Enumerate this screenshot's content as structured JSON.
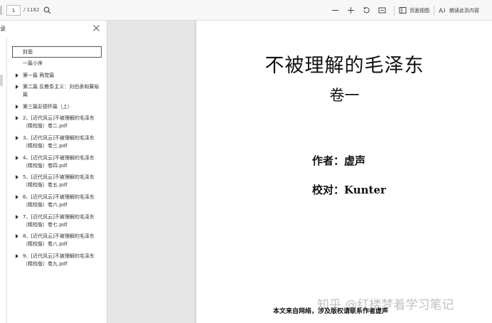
{
  "toolbar": {
    "page_current": "1",
    "page_total": "/ 1182",
    "page_view_label": "页面视图",
    "read_aloud_label": "朗读此页内容"
  },
  "sidebar": {
    "title": "录",
    "items": [
      {
        "label": "封面",
        "has_children": false,
        "selected": true
      },
      {
        "label": "一篇小序",
        "has_children": false,
        "selected": false
      },
      {
        "label": "第一篇 两党篇",
        "has_children": true,
        "selected": false
      },
      {
        "label": "第二篇 反教条主义：刘伯承和粟裕篇",
        "has_children": true,
        "selected": false
      },
      {
        "label": "第三篇彭德怀篇（上）",
        "has_children": true,
        "selected": false
      },
      {
        "label": "2、[近代风云]不被理解的毛泽东（精校版）卷二.pdf",
        "has_children": true,
        "selected": false
      },
      {
        "label": "3、[近代风云]不被理解的毛泽东（精校版）卷三.pdf",
        "has_children": true,
        "selected": false
      },
      {
        "label": "4、[近代风云]不被理解的毛泽东（精校版）卷四.pdf",
        "has_children": true,
        "selected": false
      },
      {
        "label": "5、[近代风云]不被理解的毛泽东（精校版）卷五.pdf",
        "has_children": true,
        "selected": false
      },
      {
        "label": "6、[近代风云]不被理解的毛泽东（精校版）卷六.pdf",
        "has_children": true,
        "selected": false
      },
      {
        "label": "7、[近代风云]不被理解的毛泽东（精校版）卷七.pdf",
        "has_children": true,
        "selected": false
      },
      {
        "label": "8、[近代风云]不被理解的毛泽东（精校版）卷八.pdf",
        "has_children": true,
        "selected": false
      },
      {
        "label": "9、[近代风云]不被理解的毛泽东（精校版）卷九.pdf",
        "has_children": true,
        "selected": false
      }
    ]
  },
  "document": {
    "title": "不被理解的毛泽东",
    "volume": "卷一",
    "author": "作者：虚声",
    "proofreader": "校对：Kunter",
    "footer": "本文来自网络，涉及版权请联系作者虚声",
    "watermark": "知乎 @红楼梦着学习笔记"
  },
  "icons": {
    "search": "search-icon",
    "zoom_out": "minus-icon",
    "zoom_in": "plus-icon",
    "rotate": "rotate-icon",
    "fit": "fit-page-icon",
    "page_view": "page-view-icon",
    "read_aloud": "read-aloud-icon",
    "close": "close-icon"
  }
}
